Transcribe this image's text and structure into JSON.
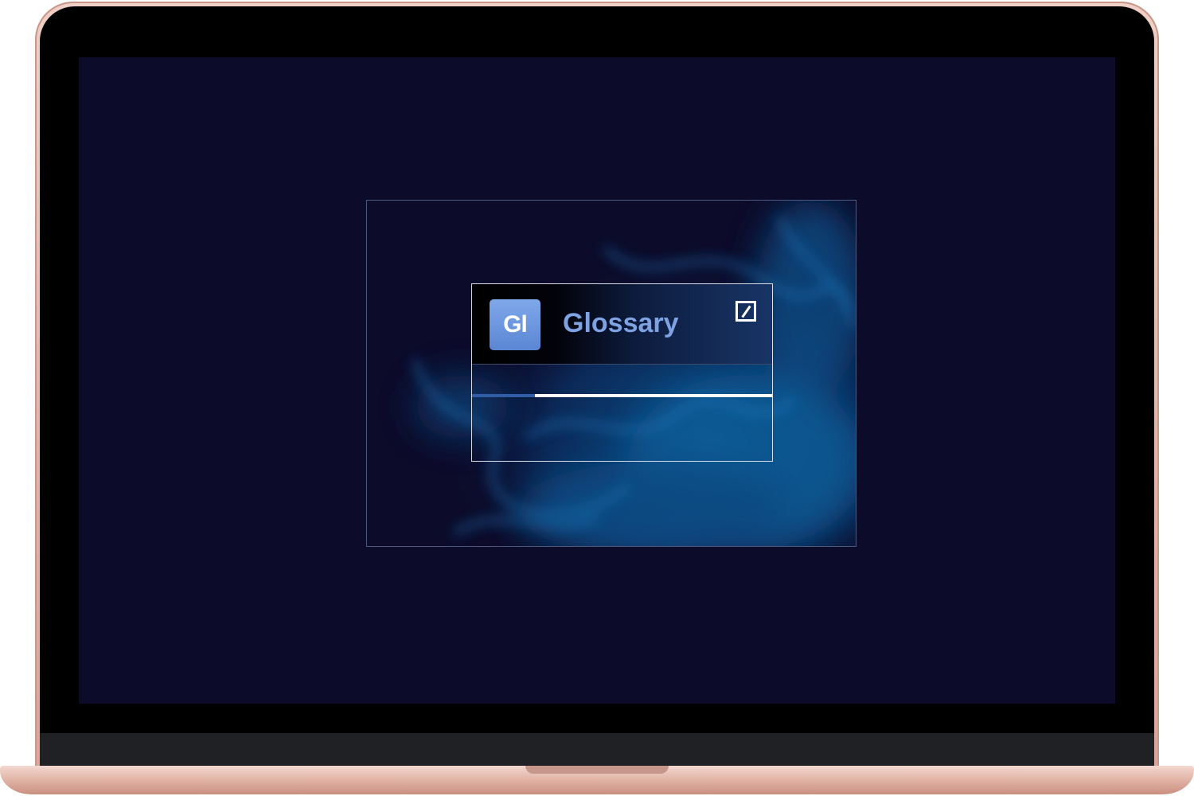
{
  "app": {
    "tile_text": "Gl",
    "title": "Glossary",
    "brand_icon": "slash-square-logo-icon",
    "progress": 0.21
  },
  "colors": {
    "screen_background": "#0c0b2a",
    "title_text": "#7ea2e2",
    "tile": "#6a95e0",
    "progress_fill": "#2f5ea7",
    "progress_track": "#ffffff",
    "device_frame": "#e2b4a7"
  }
}
